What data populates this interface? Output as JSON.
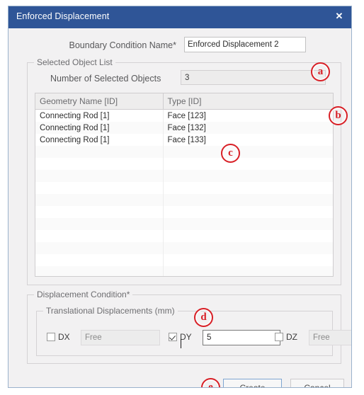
{
  "dialog": {
    "title": "Enforced Displacement",
    "close_icon": "close-icon"
  },
  "name_row": {
    "label": "Boundary Condition Name*",
    "value": "Enforced Displacement 2"
  },
  "selected_object_list": {
    "group_title": "Selected Object List",
    "count_label": "Number of Selected Objects",
    "count_value": "3",
    "table": {
      "columns": [
        "Geometry Name [ID]",
        "Type [ID]"
      ],
      "rows": [
        [
          "Connecting Rod [1]",
          "Face [123]"
        ],
        [
          "Connecting Rod [1]",
          "Face [132]"
        ],
        [
          "Connecting Rod [1]",
          "Face [133]"
        ]
      ],
      "empty_row_count": 13
    }
  },
  "displacement_condition": {
    "group_title": "Displacement Condition*",
    "translational": {
      "group_title": "Translational Displacements (mm)",
      "dof": [
        {
          "key": "dx",
          "label": "DX",
          "checked": false,
          "value": "Free",
          "enabled": false
        },
        {
          "key": "dy",
          "label": "DY",
          "checked": true,
          "value": "5",
          "enabled": true
        },
        {
          "key": "dz",
          "label": "DZ",
          "checked": false,
          "value": "Free",
          "enabled": false
        }
      ]
    }
  },
  "footer": {
    "create_label": "Create",
    "cancel_label": "Cancel"
  },
  "annotations": [
    {
      "id": "a",
      "label": "a"
    },
    {
      "id": "b",
      "label": "b"
    },
    {
      "id": "c",
      "label": "c"
    },
    {
      "id": "d",
      "label": "d"
    },
    {
      "id": "e",
      "label": "e"
    }
  ],
  "colors": {
    "titlebar": "#2f5597",
    "annotation_red": "#d81f26",
    "dialog_bg": "#f2f1f2",
    "focus_border": "#7ea6d2"
  }
}
